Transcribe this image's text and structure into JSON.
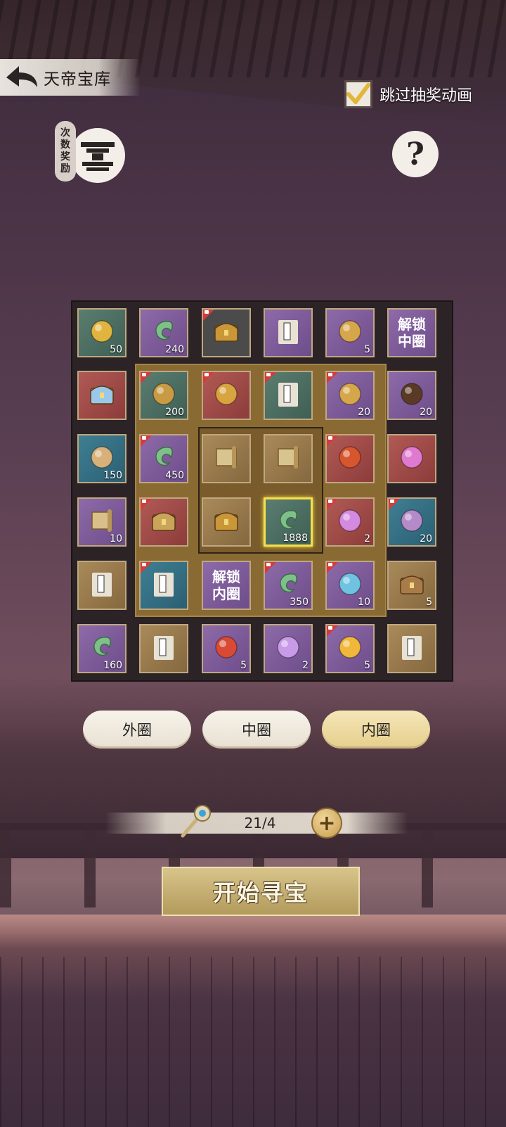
{
  "header": {
    "title": "天帝宝库",
    "skip_label": "跳过抽奖动画",
    "skip_checked": true,
    "count_reward_tag": [
      "次",
      "数",
      "奖",
      "励"
    ],
    "help_symbol": "?"
  },
  "board": {
    "outer": [
      {
        "pos": 0,
        "icon": "gold-beans-icon",
        "color": "green",
        "count": "50",
        "locked": false
      },
      {
        "pos": 1,
        "icon": "jade-pendant-icon",
        "color": "purple",
        "count": "240",
        "locked": false
      },
      {
        "pos": 2,
        "icon": "treasure-chest-icon",
        "color": "dark",
        "count": "",
        "locked": true
      },
      {
        "pos": 3,
        "icon": "book-icon",
        "color": "purple",
        "count": "",
        "locked": false
      },
      {
        "pos": 4,
        "icon": "amulet-icon",
        "color": "purple",
        "count": "5",
        "locked": false
      },
      {
        "pos": 5,
        "icon": "",
        "color": "purple",
        "count": "",
        "locked": false,
        "unlock": "解锁\n中圈"
      },
      {
        "pos": 6,
        "icon": "magic-chest-icon",
        "color": "red",
        "count": "",
        "locked": false
      },
      {
        "pos": 7,
        "icon": "seeds-icon",
        "color": "purple",
        "count": "20",
        "locked": false
      },
      {
        "pos": 8,
        "icon": "ore-icon",
        "color": "blue",
        "count": "150",
        "locked": false
      },
      {
        "pos": 9,
        "icon": "flower-lantern-icon",
        "color": "red",
        "count": "",
        "locked": false
      },
      {
        "pos": 10,
        "icon": "bamboo-scroll-icon",
        "color": "purple",
        "count": "10",
        "locked": false
      },
      {
        "pos": 11,
        "icon": "crystal-ball-icon",
        "color": "blue",
        "count": "20",
        "locked": true
      },
      {
        "pos": 12,
        "icon": "book-icon",
        "color": "gold",
        "count": "",
        "locked": false
      },
      {
        "pos": 13,
        "icon": "wooden-chest-icon",
        "color": "gold",
        "count": "5",
        "locked": false
      },
      {
        "pos": 14,
        "icon": "jade-pendant-icon",
        "color": "purple",
        "count": "160",
        "locked": false
      },
      {
        "pos": 15,
        "icon": "book-icon",
        "color": "gold",
        "count": "",
        "locked": false
      },
      {
        "pos": 16,
        "icon": "red-orb-icon",
        "color": "purple",
        "count": "5",
        "locked": false
      },
      {
        "pos": 17,
        "icon": "butterfly-icon",
        "color": "purple",
        "count": "2",
        "locked": false
      },
      {
        "pos": 18,
        "icon": "golden-flame-icon",
        "color": "purple",
        "count": "5",
        "locked": true
      },
      {
        "pos": 19,
        "icon": "book-icon",
        "color": "gold",
        "count": "",
        "locked": false
      }
    ],
    "middle": [
      {
        "pos": 0,
        "icon": "hourglass-icon",
        "color": "green",
        "count": "200",
        "locked": true
      },
      {
        "pos": 1,
        "icon": "golden-beast-icon",
        "color": "red",
        "count": "",
        "locked": true
      },
      {
        "pos": 2,
        "icon": "book-icon",
        "color": "green",
        "count": "",
        "locked": true
      },
      {
        "pos": 3,
        "icon": "amulet-icon",
        "color": "purple",
        "count": "20",
        "locked": true
      },
      {
        "pos": 4,
        "icon": "jade-pendant-icon",
        "color": "purple",
        "count": "450",
        "locked": true
      },
      {
        "pos": 5,
        "icon": "red-lantern-icon",
        "color": "red",
        "count": "",
        "locked": true
      },
      {
        "pos": 6,
        "icon": "ornate-chest-icon",
        "color": "red",
        "count": "",
        "locked": true
      },
      {
        "pos": 7,
        "icon": "lotus-icon",
        "color": "red",
        "count": "2",
        "locked": true
      },
      {
        "pos": 8,
        "icon": "book-icon",
        "color": "blue",
        "count": "",
        "locked": true
      },
      {
        "pos": 9,
        "icon": "",
        "color": "purple",
        "count": "",
        "locked": false,
        "unlock": "解锁\n内圈"
      },
      {
        "pos": 10,
        "icon": "jade-pendant-icon",
        "color": "purple",
        "count": "350",
        "locked": true
      },
      {
        "pos": 11,
        "icon": "water-swirl-icon",
        "color": "purple",
        "count": "10",
        "locked": true
      }
    ],
    "inner": [
      {
        "pos": 0,
        "icon": "scroll-map-icon",
        "color": "gold",
        "count": "",
        "locked": false
      },
      {
        "pos": 1,
        "icon": "scroll-map-icon",
        "color": "gold",
        "count": "",
        "locked": false
      },
      {
        "pos": 2,
        "icon": "treasure-chest-icon",
        "color": "gold",
        "count": "",
        "locked": false
      },
      {
        "pos": 3,
        "icon": "jade-pendant-icon",
        "color": "green",
        "count": "1888",
        "locked": false,
        "selected": true
      }
    ]
  },
  "tabs": [
    {
      "label": "外圈",
      "active": false
    },
    {
      "label": "中圈",
      "active": false
    },
    {
      "label": "内圈",
      "active": true
    }
  ],
  "keys": {
    "count": "21/4",
    "plus": "+"
  },
  "start_button": "开始寻宝",
  "colors": {
    "purple": "#7a5a98",
    "green": "#4e6f63",
    "blue": "#347083",
    "red": "#a04b4a",
    "gold": "#987a4c",
    "select": "#f4e04a"
  }
}
